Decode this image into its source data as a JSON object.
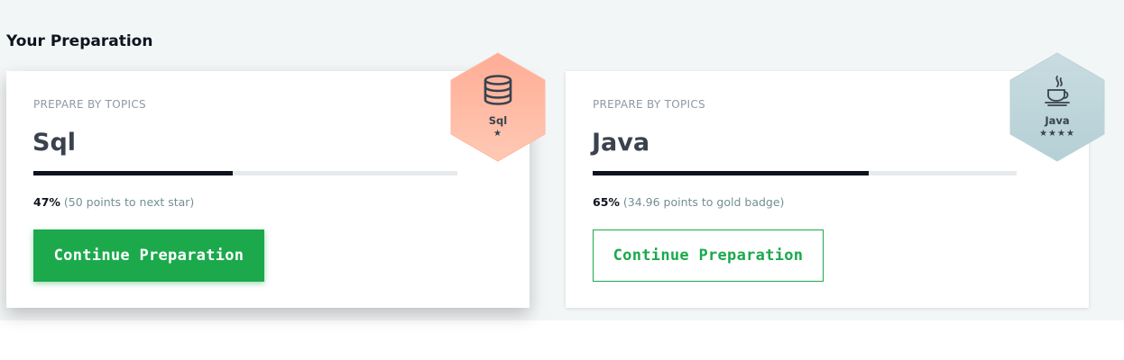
{
  "section": {
    "title": "Your Preparation"
  },
  "cards": [
    {
      "kicker": "PREPARE BY TOPICS",
      "topic": "Sql",
      "percent_label": "47%",
      "progress": 0.47,
      "detail": "(50 points to next star)",
      "button_label": "Continue Preparation",
      "button_style": "primary",
      "badge": {
        "name": "Sql",
        "stars": "★",
        "icon": "database-icon",
        "color_top": "#ffac95",
        "color_bottom": "#ffc9b4"
      }
    },
    {
      "kicker": "PREPARE BY TOPICS",
      "topic": "Java",
      "percent_label": "65%",
      "progress": 0.65,
      "detail": "(34.96 points to gold badge)",
      "button_label": "Continue Preparation",
      "button_style": "secondary",
      "badge": {
        "name": "Java",
        "stars": "★★★★",
        "icon": "java-coffee-icon",
        "color_top": "#c8dce0",
        "color_bottom": "#b5d0d5"
      }
    }
  ],
  "colors": {
    "accent_green": "#1ba94c",
    "progress_dark": "#0e141e",
    "track": "#e7eaec"
  }
}
